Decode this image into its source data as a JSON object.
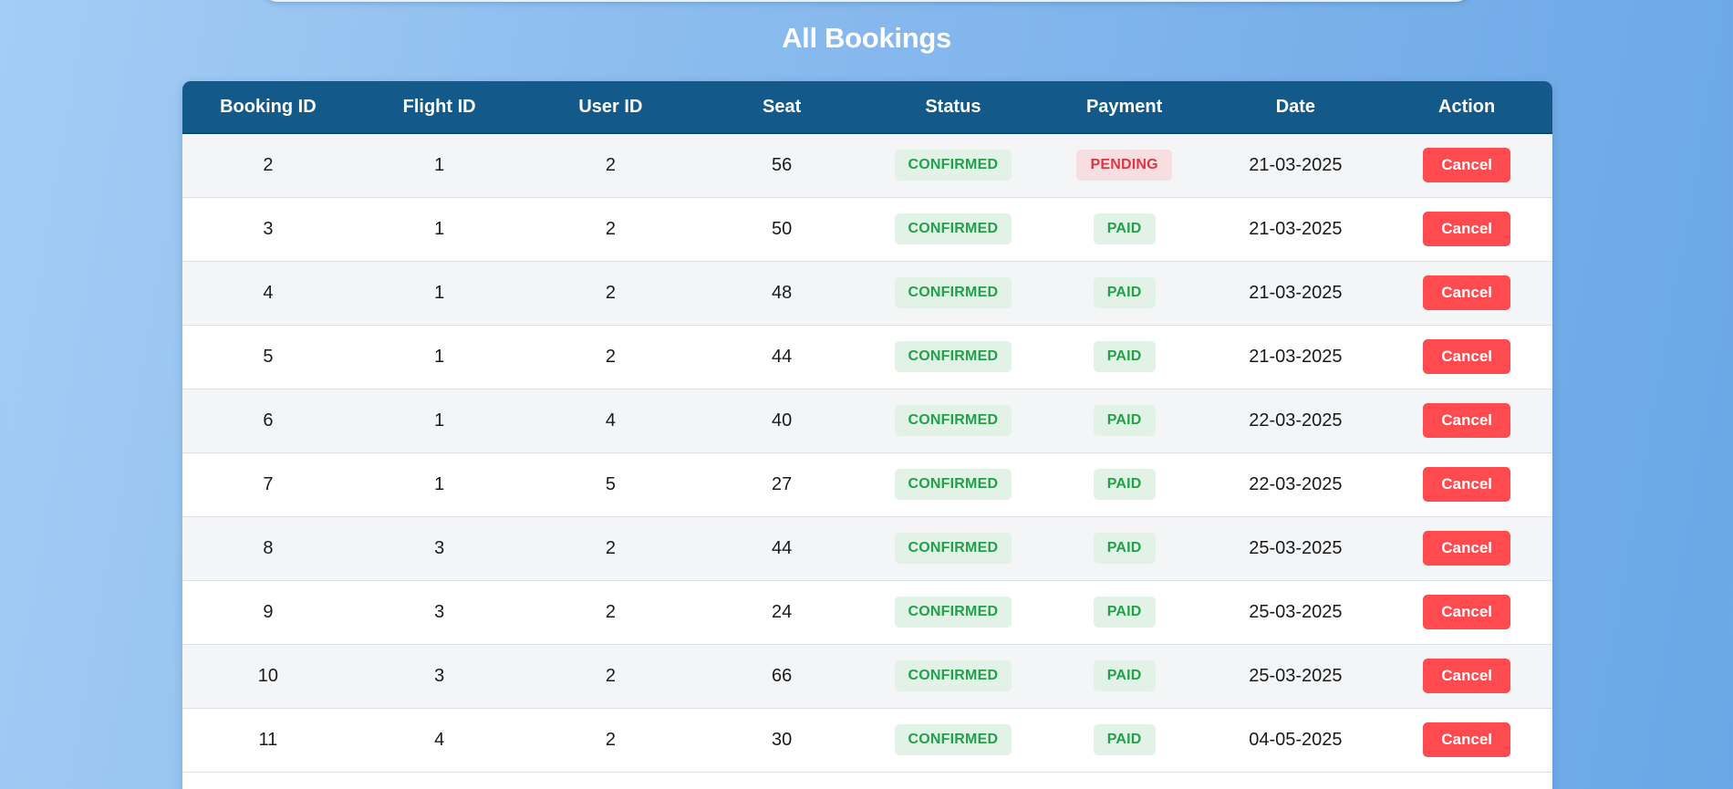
{
  "page": {
    "title": "All Bookings"
  },
  "table": {
    "headers": [
      "Booking ID",
      "Flight ID",
      "User ID",
      "Seat",
      "Status",
      "Payment",
      "Date",
      "Action"
    ],
    "rows": [
      {
        "booking_id": "2",
        "flight_id": "1",
        "user_id": "2",
        "seat": "56",
        "status": "CONFIRMED",
        "payment": "PENDING",
        "date": "21-03-2025",
        "action": "Cancel"
      },
      {
        "booking_id": "3",
        "flight_id": "1",
        "user_id": "2",
        "seat": "50",
        "status": "CONFIRMED",
        "payment": "PAID",
        "date": "21-03-2025",
        "action": "Cancel"
      },
      {
        "booking_id": "4",
        "flight_id": "1",
        "user_id": "2",
        "seat": "48",
        "status": "CONFIRMED",
        "payment": "PAID",
        "date": "21-03-2025",
        "action": "Cancel"
      },
      {
        "booking_id": "5",
        "flight_id": "1",
        "user_id": "2",
        "seat": "44",
        "status": "CONFIRMED",
        "payment": "PAID",
        "date": "21-03-2025",
        "action": "Cancel"
      },
      {
        "booking_id": "6",
        "flight_id": "1",
        "user_id": "4",
        "seat": "40",
        "status": "CONFIRMED",
        "payment": "PAID",
        "date": "22-03-2025",
        "action": "Cancel"
      },
      {
        "booking_id": "7",
        "flight_id": "1",
        "user_id": "5",
        "seat": "27",
        "status": "CONFIRMED",
        "payment": "PAID",
        "date": "22-03-2025",
        "action": "Cancel"
      },
      {
        "booking_id": "8",
        "flight_id": "3",
        "user_id": "2",
        "seat": "44",
        "status": "CONFIRMED",
        "payment": "PAID",
        "date": "25-03-2025",
        "action": "Cancel"
      },
      {
        "booking_id": "9",
        "flight_id": "3",
        "user_id": "2",
        "seat": "24",
        "status": "CONFIRMED",
        "payment": "PAID",
        "date": "25-03-2025",
        "action": "Cancel"
      },
      {
        "booking_id": "10",
        "flight_id": "3",
        "user_id": "2",
        "seat": "66",
        "status": "CONFIRMED",
        "payment": "PAID",
        "date": "25-03-2025",
        "action": "Cancel"
      },
      {
        "booking_id": "11",
        "flight_id": "4",
        "user_id": "2",
        "seat": "30",
        "status": "CONFIRMED",
        "payment": "PAID",
        "date": "04-05-2025",
        "action": "Cancel"
      }
    ]
  },
  "colors": {
    "header_bg": "#135a8a",
    "confirmed": "#22a04a",
    "paid": "#22a04a",
    "pending": "#dc3545",
    "cancel_button": "#ff4b4f"
  }
}
